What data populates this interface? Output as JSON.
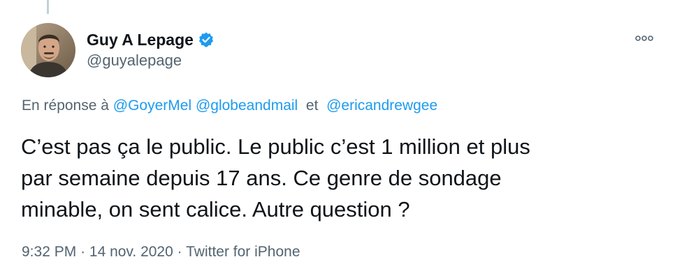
{
  "author": {
    "display_name": "Guy A Lepage",
    "handle": "@guyalepage",
    "verified": true
  },
  "reply_context": {
    "prefix": "En réponse à",
    "mention_1": "@GoyerMel",
    "mention_2": "@globeandmail",
    "separator": "et",
    "mention_3": "@ericandrewgee"
  },
  "tweet": {
    "line_1": "C’est pas ça le public. Le public c’est 1 million et plus",
    "line_2": "par semaine depuis 17 ans. Ce genre de sondage",
    "line_3": "minable, on sent calice. Autre question ?"
  },
  "meta": {
    "time": "9:32 PM",
    "dot": "·",
    "date": "14 nov. 2020",
    "source": "Twitter for iPhone"
  },
  "colors": {
    "link": "#1d9bf0",
    "secondary_text": "#536471",
    "primary_text": "#0f1419",
    "verified_badge": "#1d9bf0"
  },
  "icons": {
    "verified": "verified-badge-icon",
    "more": "more-options-icon"
  }
}
